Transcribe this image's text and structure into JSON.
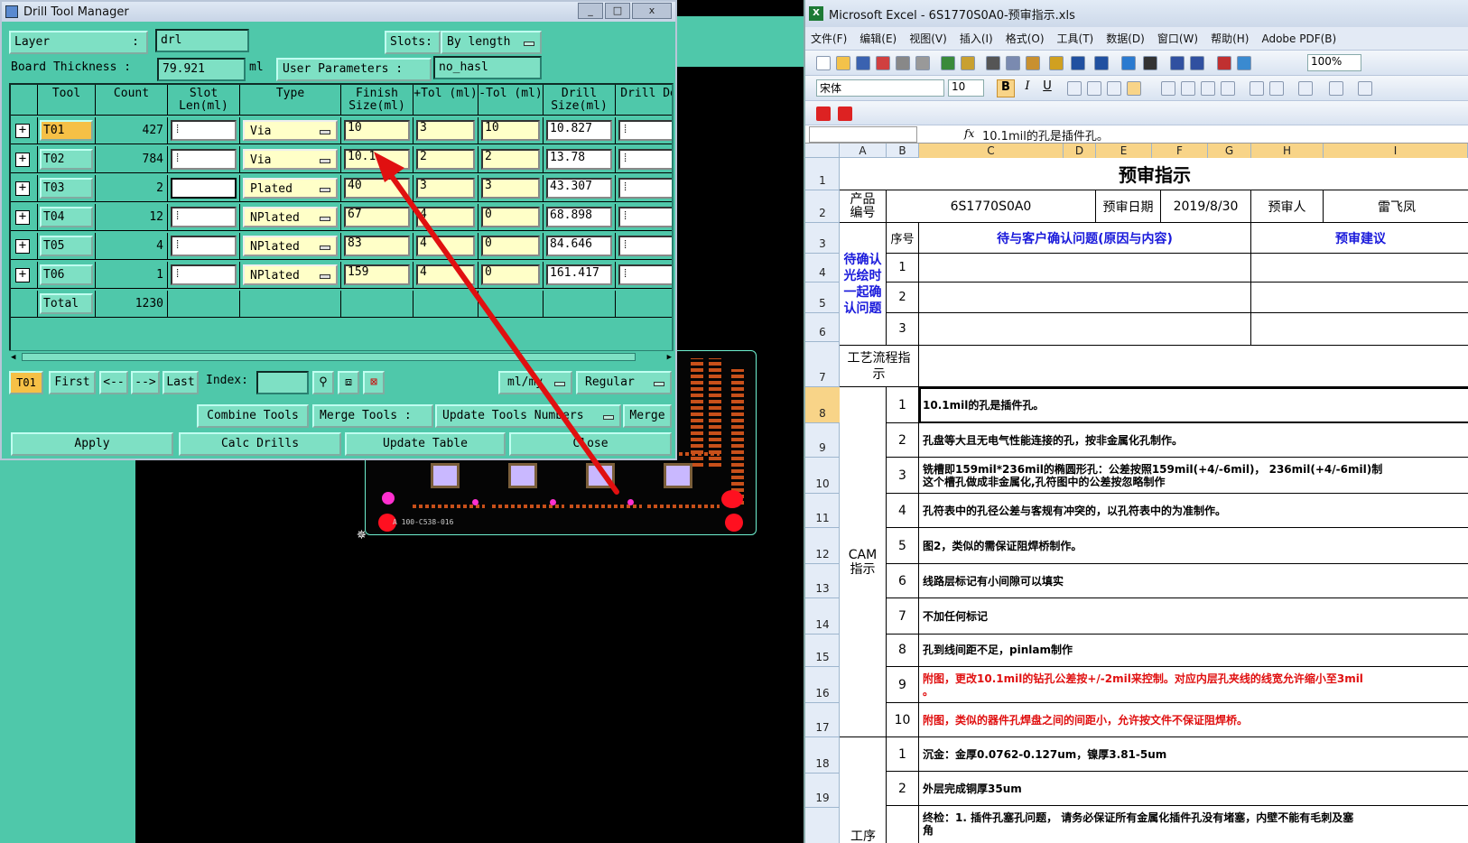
{
  "dtm": {
    "title": "Drill Tool Manager",
    "min": "_",
    "max": "□",
    "close": "x",
    "layer_label": "Layer",
    "layer_colon": ":",
    "layer_value": "drl",
    "slots_label": "Slots:",
    "slots_value": "By length",
    "board_thickness_label": "Board Thickness :",
    "board_thickness_value": "79.921",
    "board_thickness_unit": "ml",
    "user_params_label": "User Parameters :",
    "user_params_value": "no_hasl",
    "columns": [
      "Tool",
      "Count",
      "Slot Len(ml)",
      "Type",
      "Finish Size(ml)",
      "+Tol (ml)",
      "-Tol (ml)",
      "Drill Size(ml)",
      "Drill Des"
    ],
    "rows": [
      {
        "tool": "T01",
        "count": "427",
        "type": "Via",
        "finish": "10",
        "ptol": "3",
        "ntol": "10",
        "drill": "10.827"
      },
      {
        "tool": "T02",
        "count": "784",
        "type": "Via",
        "finish": "10.1",
        "ptol": "2",
        "ntol": "2",
        "drill": "13.78"
      },
      {
        "tool": "T03",
        "count": "2",
        "type": "Plated",
        "finish": "40",
        "ptol": "3",
        "ntol": "3",
        "drill": "43.307"
      },
      {
        "tool": "T04",
        "count": "12",
        "type": "NPlated",
        "finish": "67",
        "ptol": "4",
        "ntol": "0",
        "drill": "68.898"
      },
      {
        "tool": "T05",
        "count": "4",
        "type": "NPlated",
        "finish": "83",
        "ptol": "4",
        "ntol": "0",
        "drill": "84.646"
      },
      {
        "tool": "T06",
        "count": "1",
        "type": "NPlated",
        "finish": "159",
        "ptol": "4",
        "ntol": "0",
        "drill": "161.417"
      }
    ],
    "total_label": "Total",
    "total_value": "1230",
    "current_tool": "T01",
    "first": "First",
    "prev": "<--",
    "next": "-->",
    "last": "Last",
    "index_label": "Index:",
    "units": "ml/my",
    "mode": "Regular",
    "combine": "Combine Tools",
    "merge_tools": "Merge Tools :",
    "update_numbers": "Update Tools Numbers",
    "merge": "Merge",
    "apply": "Apply",
    "calc": "Calc Drills",
    "update_table": "Update Table",
    "close_btn": "Close"
  },
  "pcb": {
    "label": "A 100-C538-016"
  },
  "excel": {
    "title": "Microsoft Excel - 6S1770S0A0-预审指示.xls",
    "menu": [
      "文件(F)",
      "编辑(E)",
      "视图(V)",
      "插入(I)",
      "格式(O)",
      "工具(T)",
      "数据(D)",
      "窗口(W)",
      "帮助(H)",
      "Adobe PDF(B)"
    ],
    "zoom": "100%",
    "font": "宋体",
    "font_size": "10",
    "bold": "B",
    "italic": "I",
    "underline": "U",
    "fx": "fx",
    "formula": "10.1mil的孔是插件孔。",
    "columns": [
      "A",
      "B",
      "C",
      "D",
      "E",
      "F",
      "G",
      "H",
      "I"
    ],
    "row_numbers": [
      "1",
      "2",
      "3",
      "4",
      "5",
      "6",
      "7",
      "8",
      "9",
      "10",
      "11",
      "12",
      "13",
      "14",
      "15",
      "16",
      "17",
      "18",
      "19"
    ],
    "sheet_title": "预审指示",
    "product_label": "产品编号",
    "product_no": "6S1770S0A0",
    "review_date_label": "预审日期",
    "review_date": "2019/8/30",
    "reviewer_label": "预审人",
    "reviewer": "雷飞凤",
    "seq_label": "序号",
    "confirm_header": "待与客户确认问题(原因与内容)",
    "advice_header": "预审建议",
    "pending_label": "待确认光绘时一起确认问题",
    "process_label": "工艺流程指示",
    "cam_label": "CAM指示",
    "craft_label": "工序",
    "seq_pending": [
      "1",
      "2",
      "3"
    ],
    "cam_items": [
      {
        "no": "1",
        "text": "10.1mil的孔是插件孔。",
        "red": false
      },
      {
        "no": "2",
        "text": "孔盘等大且无电气性能连接的孔，按非金属化孔制作。",
        "red": false
      },
      {
        "no": "3",
        "text": "铣槽即159mil*236mil的椭圆形孔：公差按照159mil(+4/-6mil)， 236mil(+4/-6mil)制",
        "text2": "这个槽孔做成非金属化,孔符图中的公差按忽略制作",
        "red": false
      },
      {
        "no": "4",
        "text": "孔符表中的孔径公差与客规有冲突的，以孔符表中的为准制作。",
        "red": false
      },
      {
        "no": "5",
        "text": "图2，类似的需保证阻焊桥制作。",
        "red": false
      },
      {
        "no": "6",
        "text": "线路层标记有小间隙可以填实",
        "red": false
      },
      {
        "no": "7",
        "text": "不加任何标记",
        "red": false
      },
      {
        "no": "8",
        "text": "孔到线间距不足，pinlam制作",
        "red": false
      },
      {
        "no": "9",
        "text": "附图，更改10.1mil的钻孔公差按+/-2mil来控制。对应内层孔夹线的线宽允许缩小至3mil",
        "text2": "。",
        "red": true
      },
      {
        "no": "10",
        "text": "附图，类似的器件孔焊盘之间的间距小，允许按文件不保证阻焊桥。",
        "red": true
      }
    ],
    "craft_items": [
      {
        "no": "1",
        "text": "沉金：金厚0.0762-0.127um，镍厚3.81-5um"
      },
      {
        "no": "2",
        "text": "外层完成铜厚35um"
      },
      {
        "no": "",
        "text": "终检：1. 插件孔塞孔问题， 请务必保证所有金属化插件孔没有堵塞，内壁不能有毛刺及塞",
        "text2": "角"
      }
    ]
  },
  "colors": {
    "teal": "#4fc8aa",
    "light_teal": "#7ee0c4",
    "yellow_cell": "#ffffc8",
    "selected_tool": "#f6c046",
    "arrow": "#e01010"
  }
}
